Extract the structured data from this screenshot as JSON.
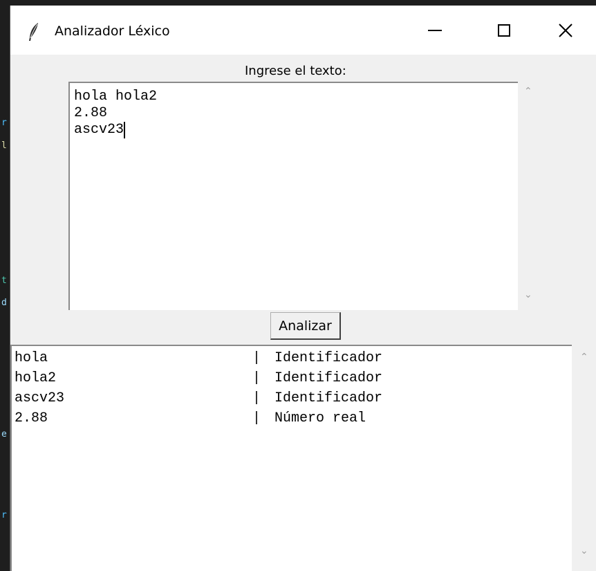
{
  "window": {
    "title": "Analizador Léxico",
    "controls": {
      "minimize": "minimize",
      "maximize": "maximize",
      "close": "close"
    }
  },
  "input": {
    "label": "Ingrese el texto:",
    "text": "hola hola2\n2.88\nascv23"
  },
  "analyze_button": "Analizar",
  "output": {
    "separator": "|",
    "rows": [
      {
        "token": "hola",
        "type": "Identificador"
      },
      {
        "token": "hola2",
        "type": "Identificador"
      },
      {
        "token": "ascv23",
        "type": "Identificador"
      },
      {
        "token": "2.88",
        "type": "Número real"
      }
    ]
  },
  "icons": {
    "app": "feather-icon",
    "scroll_up": "chevron-up-icon",
    "scroll_down": "chevron-down-icon"
  }
}
